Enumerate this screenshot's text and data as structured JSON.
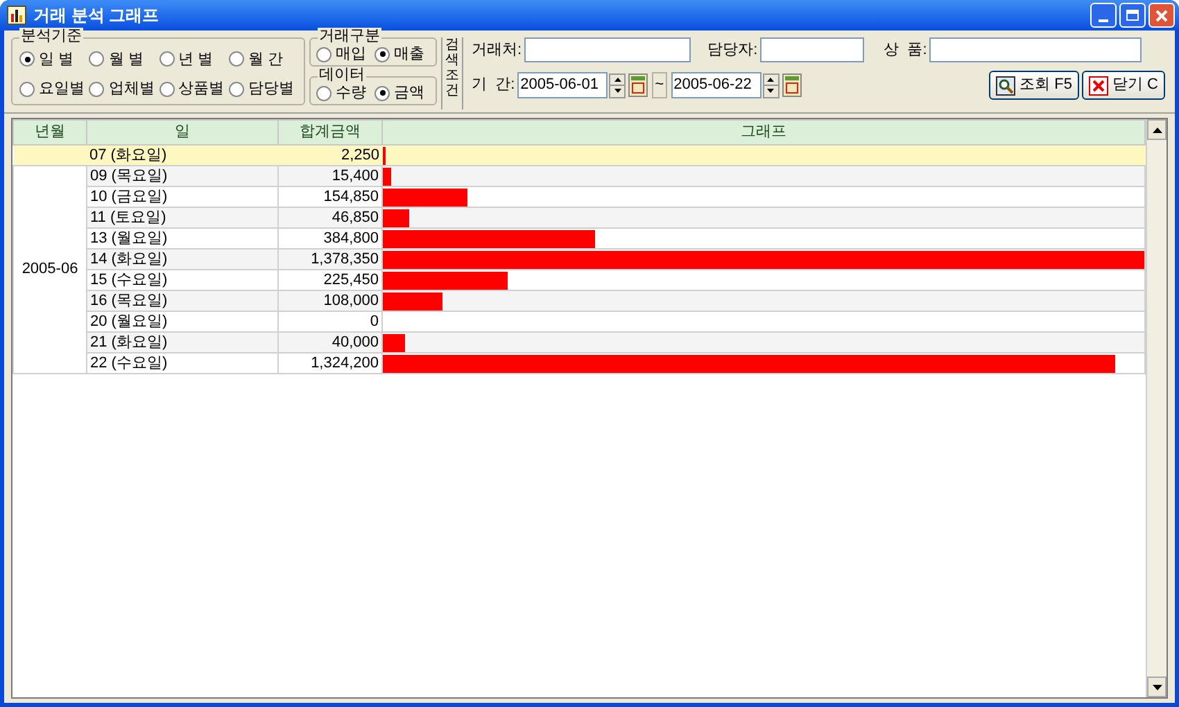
{
  "window": {
    "title": "거래 분석 그래프"
  },
  "analysis_basis": {
    "label": "분석기준",
    "options": [
      {
        "label": "일 별",
        "selected": true
      },
      {
        "label": "월 별",
        "selected": false
      },
      {
        "label": "년 별",
        "selected": false
      },
      {
        "label": "월 간",
        "selected": false
      },
      {
        "label": "요일별",
        "selected": false
      },
      {
        "label": "업체별",
        "selected": false
      },
      {
        "label": "상품별",
        "selected": false
      },
      {
        "label": "담당별",
        "selected": false
      }
    ]
  },
  "trade_type": {
    "label": "거래구분",
    "options": [
      {
        "label": "매입",
        "selected": false
      },
      {
        "label": "매출",
        "selected": true
      }
    ]
  },
  "data_type": {
    "label": "데이터",
    "options": [
      {
        "label": "수량",
        "selected": false
      },
      {
        "label": "금액",
        "selected": true
      }
    ]
  },
  "search_conditions_label": "검색조건",
  "fields": [
    {
      "label": "거래처:"
    },
    {
      "label": "담당자:"
    },
    {
      "label": "상  품:"
    }
  ],
  "period": {
    "label": "기  간:",
    "from": "2005-06-01",
    "separator": "~",
    "to": "2005-06-22"
  },
  "buttons": [
    {
      "label": "조회 F5",
      "kind": "search"
    },
    {
      "label": "닫기 C",
      "kind": "close"
    }
  ],
  "table": {
    "columns": [
      "년월",
      "일",
      "합계금액",
      "그래프"
    ],
    "year_month": "2005-06",
    "rows": [
      {
        "day": "07 (화요일)",
        "amount": "2,250",
        "level": 0.0016,
        "selected": true
      },
      {
        "day": "09 (목요일)",
        "amount": "15,400",
        "level": 0.011,
        "selected": false
      },
      {
        "day": "10 (금요일)",
        "amount": "154,850",
        "level": 0.112,
        "selected": false
      },
      {
        "day": "11 (토요일)",
        "amount": "46,850",
        "level": 0.034,
        "selected": false
      },
      {
        "day": "13 (월요일)",
        "amount": "384,800",
        "level": 0.279,
        "selected": false
      },
      {
        "day": "14 (화요일)",
        "amount": "1,378,350",
        "level": 1,
        "selected": false
      },
      {
        "day": "15 (수요일)",
        "amount": "225,450",
        "level": 0.164,
        "selected": false
      },
      {
        "day": "16 (목요일)",
        "amount": "108,000",
        "level": 0.078,
        "selected": false
      },
      {
        "day": "20 (월요일)",
        "amount": "0",
        "level": 0,
        "selected": false
      },
      {
        "day": "21 (화요일)",
        "amount": "40,000",
        "level": 0.029,
        "selected": false
      },
      {
        "day": "22 (수요일)",
        "amount": "1,324,200",
        "level": 0.961,
        "selected": false
      }
    ]
  }
}
